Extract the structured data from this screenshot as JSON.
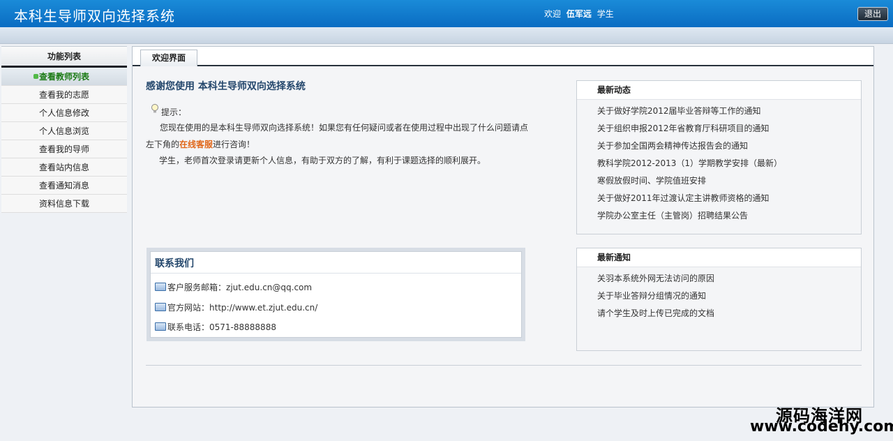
{
  "header": {
    "title": "本科生导师双向选择系统",
    "welcome_prefix": "欢迎",
    "user_name": "伍军远",
    "user_role": "学生",
    "logout_label": "退出"
  },
  "sidebar": {
    "title": "功能列表",
    "items": [
      {
        "label": "查看教师列表"
      },
      {
        "label": "查看我的志愿"
      },
      {
        "label": "个人信息修改"
      },
      {
        "label": "个人信息浏览"
      },
      {
        "label": "查看我的导师"
      },
      {
        "label": "查看站内信息"
      },
      {
        "label": "查看通知消息"
      },
      {
        "label": "资料信息下载"
      }
    ]
  },
  "tabs": [
    {
      "label": "欢迎界面"
    }
  ],
  "main": {
    "welcome_title": "感谢您使用  本科生导师双向选择系统",
    "tip_label": "提示：",
    "tip_text_1": "您现在使用的是本科生导师双向选择系统！如果您有任何疑问或者在使用过程中出现了什么问题请点左下角的",
    "tip_highlight": "在线客服",
    "tip_text_2": "进行咨询！",
    "tip_text_3": "学生，老师首次登录请更新个人信息，有助于双方的了解，有利于课题选择的顺利展开。"
  },
  "contact": {
    "title": "联系我们",
    "email_label": "客户服务邮箱：",
    "email": "zjut.edu.cn@qq.com",
    "site_label": "官方网站：",
    "site": "http://www.et.zjut.edu.cn/",
    "phone_label": "联系电话：",
    "phone": "0571-88888888"
  },
  "news": {
    "title": "最新动态",
    "items": [
      "关于做好学院2012届毕业答辩等工作的通知",
      "关于组织申报2012年省教育厅科研项目的通知",
      "关于参加全国两会精神传达报告会的通知",
      "教科学院2012-2013（1）学期教学安排（最新）",
      "寒假放假时间、学院值班安排",
      "关于做好2011年过渡认定主讲教师资格的通知",
      "学院办公室主任（主管岗）招聘结果公告"
    ]
  },
  "notices": {
    "title": "最新通知",
    "items": [
      "关羽本系统外网无法访问的原因",
      "关于毕业答辩分组情况的通知",
      "请个学生及时上传已完成的文档"
    ]
  },
  "watermark": {
    "line1": "源码海洋网",
    "line2": "www.codehy.com"
  }
}
